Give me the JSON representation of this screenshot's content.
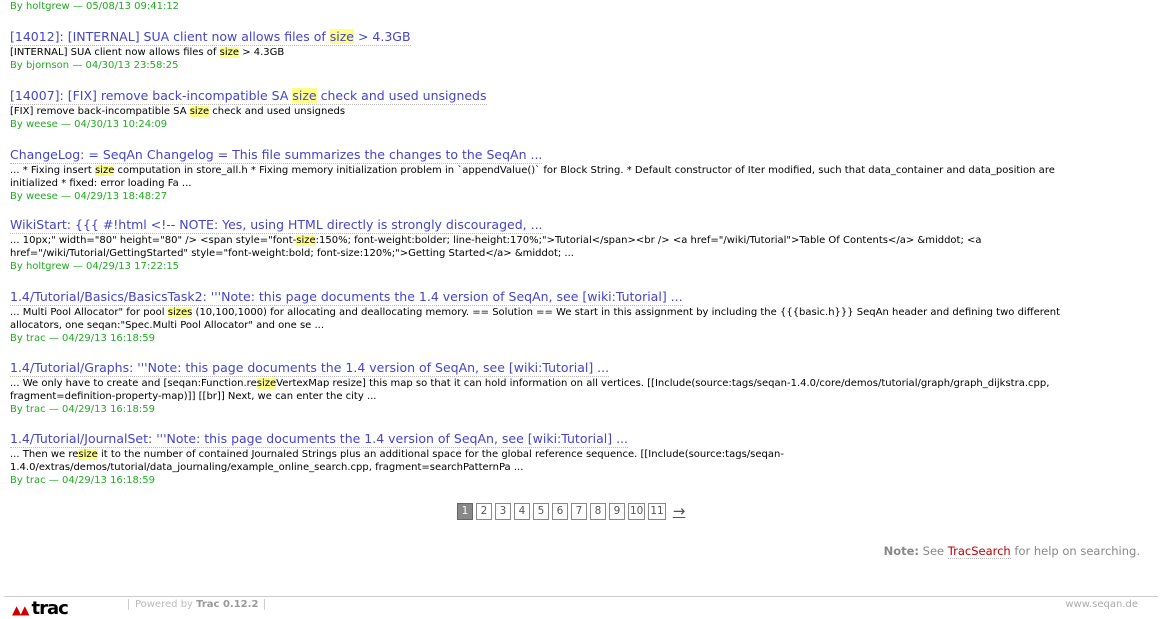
{
  "top_meta": {
    "by": "By holtgrew — 05/08/13 09:41:12"
  },
  "results": [
    {
      "title": [
        {
          "t": "[14012]: [INTERNAL] SUA client now allows files of "
        },
        {
          "t": "size",
          "hl": true
        },
        {
          "t": " > 4.3GB"
        }
      ],
      "excerpt": [
        {
          "t": "[INTERNAL] SUA client now allows files of "
        },
        {
          "t": "size",
          "hl": true
        },
        {
          "t": " > 4.3GB"
        }
      ],
      "meta": "By bjornson — 04/30/13 23:58:25"
    },
    {
      "title": [
        {
          "t": "[14007]: [FIX] remove back-incompatible SA "
        },
        {
          "t": "size",
          "hl": true
        },
        {
          "t": " check and used unsigneds"
        }
      ],
      "excerpt": [
        {
          "t": "[FIX] remove back-incompatible SA "
        },
        {
          "t": "size",
          "hl": true
        },
        {
          "t": " check and used unsigneds"
        }
      ],
      "meta": "By weese — 04/30/13 10:24:09"
    },
    {
      "title": [
        {
          "t": "ChangeLog: = SeqAn Changelog = This file summarizes the changes to the SeqAn ..."
        }
      ],
      "excerpt": [
        {
          "t": "... * Fixing insert "
        },
        {
          "t": "size",
          "hl": true
        },
        {
          "t": " computation in store_all.h * Fixing memory initialization problem in `appendValue()` for Block String. * Default constructor of Iter modified, such that data_container and data_position are initialized * fixed: error loading Fa ..."
        }
      ],
      "meta": "By weese — 04/29/13 18:48:27"
    },
    {
      "title": [
        {
          "t": "WikiStart: {{{ #!html <!-- NOTE: Yes, using HTML directly is strongly discouraged, ..."
        }
      ],
      "excerpt": [
        {
          "t": "... 10px;\" width=\"80\" height=\"80\" /> <span style=\"font-"
        },
        {
          "t": "size",
          "hl": true
        },
        {
          "t": ":150%; font-weight:bolder; line-height:170%;\">Tutorial</span><br /> <a href=\"/wiki/Tutorial\">Table Of Contents</a> &middot; <a href=\"/wiki/Tutorial/GettingStarted\" style=\"font-weight:bold; font-size:120%;\">Getting Started</a> &middot; ..."
        }
      ],
      "meta": "By holtgrew — 04/29/13 17:22:15"
    },
    {
      "title": [
        {
          "t": "1.4/Tutorial/Basics/BasicsTask2: '''Note: this page documents the 1.4 version of SeqAn, see [wiki:Tutorial] ..."
        }
      ],
      "excerpt": [
        {
          "t": "... Multi Pool Allocator\" for pool "
        },
        {
          "t": "sizes",
          "hl": true
        },
        {
          "t": " (10,100,1000) for allocating and deallocating memory. == Solution == We start in this assignment by including the {{{basic.h}}} SeqAn header and defining two different allocators, one seqan:\"Spec.Multi Pool Allocator\" and one se ..."
        }
      ],
      "meta": "By trac — 04/29/13 16:18:59"
    },
    {
      "title": [
        {
          "t": "1.4/Tutorial/Graphs: '''Note: this page documents the 1.4 version of SeqAn, see [wiki:Tutorial] ..."
        }
      ],
      "excerpt": [
        {
          "t": "... We only have to create and [seqan:Function.re"
        },
        {
          "t": "size",
          "hl": true
        },
        {
          "t": "VertexMap resize] this map so that it can hold information on all vertices. [[Include(source:tags/seqan-1.4.0/core/demos/tutorial/graph/graph_dijkstra.cpp, fragment=definition-property-map)]] [[br]] Next, we can enter the city ..."
        }
      ],
      "meta": "By trac — 04/29/13 16:18:59"
    },
    {
      "title": [
        {
          "t": "1.4/Tutorial/JournalSet: '''Note: this page documents the 1.4 version of SeqAn, see [wiki:Tutorial] ..."
        }
      ],
      "excerpt": [
        {
          "t": "... Then we re"
        },
        {
          "t": "size",
          "hl": true
        },
        {
          "t": " it to the number of contained Journaled Strings plus an additional space for the global reference sequence. [[Include(source:tags/seqan-1.4.0/extras/demos/tutorial/data_journaling/example_online_search.cpp, fragment=searchPatternPa ..."
        }
      ],
      "meta": "By trac — 04/29/13 16:18:59"
    }
  ],
  "pager": {
    "pages": [
      "1",
      "2",
      "3",
      "4",
      "5",
      "6",
      "7",
      "8",
      "9",
      "10",
      "11"
    ],
    "current": "1",
    "next": "→"
  },
  "note": {
    "label": "Note:",
    "pre": "See",
    "link": "TracSearch",
    "post": "for help on searching."
  },
  "footer": {
    "logo": "trac",
    "powered_pre": "Powered by",
    "powered_name": "Trac 0.12.2",
    "site": "www.seqan.de"
  }
}
